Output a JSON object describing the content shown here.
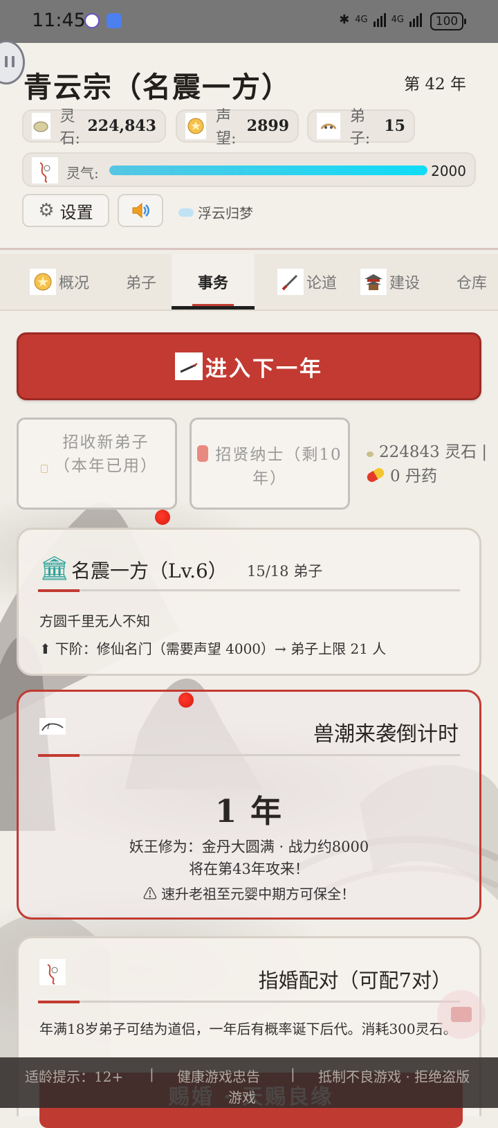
{
  "status_bar": {
    "time": "11:45",
    "network_1": "4G",
    "network_2": "4G",
    "battery": "100"
  },
  "header": {
    "title": "青云宗（名震一方）",
    "year": "第 42 年",
    "stats": [
      {
        "icon": "spirit-stone-icon",
        "label": "灵石:",
        "value": "224,843"
      },
      {
        "icon": "prestige-icon",
        "label": "声望:",
        "value": "2899"
      },
      {
        "icon": "disciple-icon",
        "label": "弟子:",
        "value": "15"
      }
    ],
    "qi": {
      "label": "灵气:",
      "value": "2000",
      "fill_fraction": 1.0
    },
    "settings_label": "设置",
    "music_title": "浮云归梦"
  },
  "tabs": [
    {
      "label": "概况",
      "icon": "star-badge-icon",
      "active": false
    },
    {
      "label": "弟子",
      "icon": "",
      "active": false
    },
    {
      "label": "事务",
      "icon": "",
      "active": true
    },
    {
      "label": "论道",
      "icon": "sword-icon",
      "active": false
    },
    {
      "label": "建设",
      "icon": "pavilion-icon",
      "active": false
    },
    {
      "label": "仓库",
      "icon": "",
      "active": false
    }
  ],
  "next_year_label": "进入下一年",
  "actions": {
    "recruit_label": "招收新弟子（本年已用）",
    "talent_label": "招贤纳士（剩10年）",
    "resources_line1": "224843 灵石 |",
    "resources_line2": "0 丹药"
  },
  "sect_card": {
    "name": "名震一方（Lv.6）",
    "disciples": "15/18 弟子",
    "motto": "方圆千里无人不知",
    "upgrade": "下阶：修仙名门（需要声望 4000）→ 弟子上限 21 人"
  },
  "beast_card": {
    "title": "兽潮来袭倒计时",
    "countdown": "1 年",
    "line1": "妖王修为：金丹大圆满 · 战力约8000",
    "line2": "将在第43年攻来！",
    "line3": "⚠ 速升老祖至元婴中期方可保全！"
  },
  "marriage_card": {
    "title": "指婚配对（可配7对）",
    "desc": "年满18岁弟子可结为道侣，一年后有概率诞下后代。消耗300灵石。",
    "button": "赐婚 · 天赐良缘"
  },
  "notice": {
    "age": "适龄提示：12+",
    "sep": "|",
    "health": "健康游戏忠告",
    "anti": "抵制不良游戏 · 拒绝盗版",
    "game": "游戏"
  },
  "colors": {
    "accent_red": "#c23a31",
    "qi_cyan": "#10dcf7",
    "teal_icon": "#2aa39a"
  }
}
